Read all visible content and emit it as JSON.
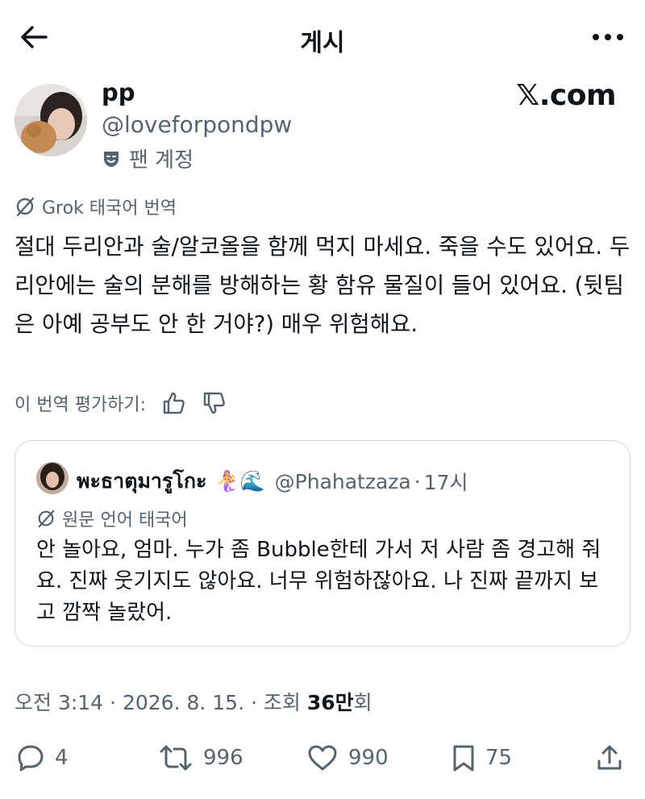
{
  "header": {
    "title": "게시"
  },
  "post": {
    "author": {
      "display_name": "pp",
      "handle": "@loveforpondpw",
      "badge_label": "팬 계정"
    },
    "source_mark": "𝕏.com",
    "translation_label": "Grok 태국어 번역",
    "text": "절대 두리안과 술/알코올을 함께 먹지 마세요. 죽을 수도 있어요. 두리안에는 술의 분해를 방해하는 황 함유 물질이 들어 있어요. (뒷팀은 아예 공부도 안 한 거야?) 매우 위험해요.",
    "rate_label": "이 번역 평가하기:",
    "meta": {
      "time": "오전 3:14",
      "date": "2026. 8. 15.",
      "views_prefix": "조회",
      "views_value": "36만",
      "views_suffix": "회"
    }
  },
  "quote": {
    "display_name": "พะธาตุมารูโกะ",
    "emoji": "🧜‍♀️🌊",
    "handle": "@Phahatzaza",
    "time": "17시",
    "lang_label": "원문 언어 태국어",
    "text": "안 놀아요, 엄마. 누가 좀 Bubble한테 가서 저 사람 좀 경고해 줘요. 진짜 웃기지도 않아요. 너무 위험하잖아요. 나 진짜 끝까지 보고 깜짝 놀랐어."
  },
  "actions": {
    "replies": "4",
    "reposts": "996",
    "likes": "990",
    "bookmarks": "75"
  },
  "colors": {
    "text_primary": "#0f1419",
    "text_secondary": "#536471",
    "border": "#cfd9de",
    "background": "#ffffff"
  }
}
